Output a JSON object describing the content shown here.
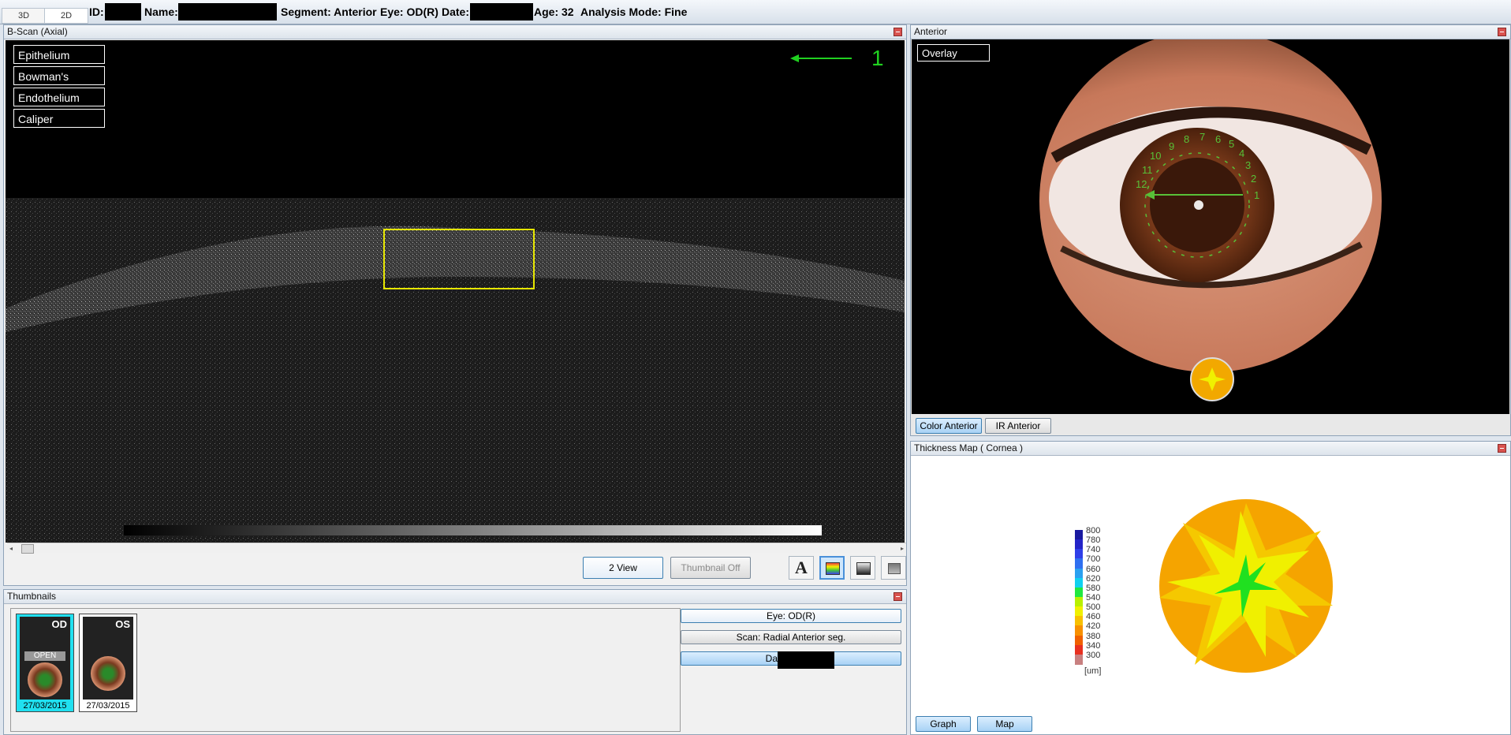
{
  "header": {
    "tabs": [
      {
        "label": "3D"
      },
      {
        "label": "2D"
      }
    ],
    "id_label": "ID:",
    "name_label": "Name:",
    "segment": "Segment: Anterior",
    "eye": "Eye: OD(R)",
    "date_label": "Date:",
    "age": "Age: 32",
    "analysis_mode": "Analysis Mode: Fine"
  },
  "bscan": {
    "title": "B-Scan (Axial)",
    "layers": [
      "Epithelium",
      "Bowman's",
      "Endothelium",
      "Caliper"
    ],
    "scan_marker": "1",
    "buttons": {
      "two_view": "2 View",
      "thumbnail_off": "Thumbnail Off"
    },
    "tools": [
      "text-tool-icon",
      "color-map-icon",
      "grayscale-icon",
      "gradient-icon"
    ]
  },
  "anterior": {
    "title": "Anterior",
    "overlay_label": "Overlay",
    "clock_numbers": [
      "1",
      "2",
      "3",
      "4",
      "5",
      "6",
      "7",
      "8",
      "9",
      "10",
      "11",
      "12"
    ],
    "buttons": {
      "color": "Color Anterior",
      "ir": "IR Anterior"
    }
  },
  "thickness": {
    "title": "Thickness Map   ( Cornea )",
    "legend": [
      "800",
      "780",
      "740",
      "700",
      "660",
      "620",
      "580",
      "540",
      "500",
      "460",
      "420",
      "380",
      "340",
      "300"
    ],
    "legend_colors": [
      "#1a1aa0",
      "#2424c8",
      "#2f3fe8",
      "#2f6ff0",
      "#2aa0f0",
      "#10d0f0",
      "#20e840",
      "#b8f000",
      "#f0f000",
      "#f8c000",
      "#f89000",
      "#f06000",
      "#e83020",
      "#c88080"
    ],
    "unit": "[um]",
    "buttons": {
      "graph": "Graph",
      "map": "Map"
    }
  },
  "thumbnails": {
    "title": "Thumbnails",
    "items": [
      {
        "eye": "OD",
        "status": "OPEN",
        "date": "27/03/2015",
        "selected": true
      },
      {
        "eye": "OS",
        "status": "",
        "date": "27/03/2015",
        "selected": false
      }
    ],
    "info_buttons": {
      "eye": "Eye: OD(R)",
      "scan": "Scan: Radial Anterior seg.",
      "date": "Date:"
    }
  }
}
